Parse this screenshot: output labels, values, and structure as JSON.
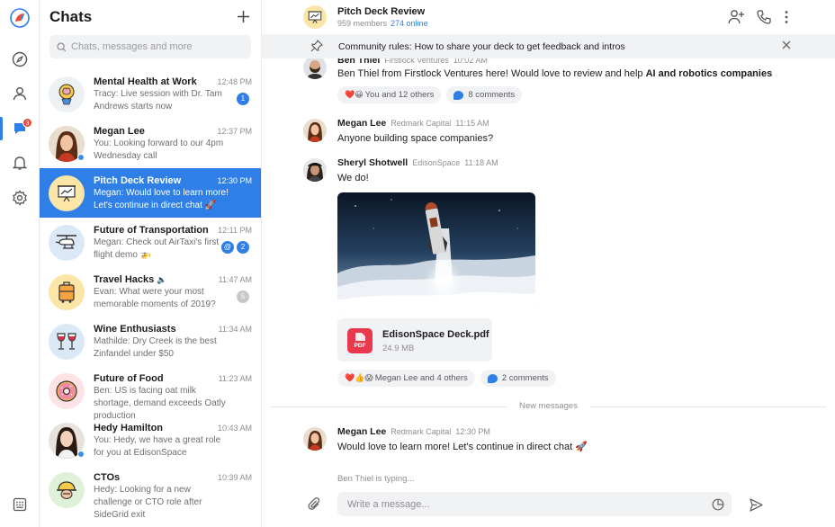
{
  "colors": {
    "accent": "#2f7fe6",
    "badge": "#e84b3c",
    "pdf": "#e8394f"
  },
  "rail": {
    "items": [
      "logo-icon",
      "compass-icon",
      "profile-icon",
      "chat-icon",
      "bell-icon",
      "gear-icon",
      "grid-icon"
    ],
    "chat_badge": "3"
  },
  "list": {
    "title": "Chats",
    "search_placeholder": "Chats, messages and more",
    "items": [
      {
        "name": "Mental Health at Work",
        "time": "12:48 PM",
        "preview": "Tracy: Live session with Dr. Tam Andrews starts now",
        "counts": [
          "1"
        ],
        "avatar_icon": "brain-icon"
      },
      {
        "name": "Megan Lee",
        "time": "12:37 PM",
        "preview": "You: Looking forward to our 4pm Wednesday call",
        "counts": [],
        "avatar_icon": "person-photo"
      },
      {
        "name": "Pitch Deck Review",
        "time": "12:30 PM",
        "preview": "Megan: Would love to learn more! Let's continue in direct chat 🚀",
        "counts": [],
        "avatar_icon": "presentation-icon"
      },
      {
        "name": "Future of Transportation",
        "time": "12:11 PM",
        "preview": "Megan: Check out AirTaxi's first flight demo 🚁",
        "counts": [
          "@",
          "2"
        ],
        "avatar_icon": "helicopter-icon"
      },
      {
        "name": "Travel Hacks",
        "time": "11:47 AM",
        "preview": "Evan: What were your most memorable moments of 2019?",
        "counts": [
          "5"
        ],
        "avatar_icon": "suitcase-icon"
      },
      {
        "name": "Wine Enthusiasts",
        "time": "11:34 AM",
        "preview": "Mathilde: Dry Creek is the best Zinfandel under $50",
        "counts": [],
        "avatar_icon": "wine-icon"
      },
      {
        "name": "Future of Food",
        "time": "11:23 AM",
        "preview": "Ben: US is facing oat milk shortage, demand exceeds Oatly production",
        "counts": [],
        "avatar_icon": "donut-icon"
      },
      {
        "name": "Hedy Hamilton",
        "time": "10:43 AM",
        "preview": "You: Hedy, we have a great role for you at EdisonSpace",
        "counts": [],
        "avatar_icon": "person-photo"
      },
      {
        "name": "CTOs",
        "time": "10:39 AM",
        "preview": "Hedy: Looking for a new challenge or CTO role after SideGrid exit",
        "counts": [],
        "avatar_icon": "helmet-icon"
      }
    ]
  },
  "header": {
    "title": "Pitch Deck Review",
    "members": "959 members",
    "online": "274 online"
  },
  "pinned": {
    "text": "Community rules: How to share your deck to get feedback and intros"
  },
  "messages": [
    {
      "name": "Ben Thiel",
      "company": "Firstlock Ventures",
      "time": "10:02 AM",
      "text_plain": "Ben Thiel from Firstlock Ventures here! Would love to review and help ",
      "text_bold": "AI and robotics companies",
      "reactions": {
        "emoji": "❤️😀",
        "who": "You and 12 others"
      },
      "comments": "8 comments"
    },
    {
      "name": "Megan Lee",
      "company": "Redmark Capital",
      "time": "11:15 AM",
      "text": "Anyone building space companies?"
    },
    {
      "name": "Sheryl Shotwell",
      "company": "EdisonSpace",
      "time": "11:18 AM",
      "text": "We do!",
      "attachment": {
        "name": "EdisonSpace Deck.pdf",
        "size": "24.9 MB",
        "type": "PDF"
      },
      "reactions": {
        "emoji": "❤️👍😱",
        "who": "Megan Lee and 4 others"
      },
      "comments": "2 comments"
    },
    {
      "name": "Megan Lee",
      "company": "Redmark Capital",
      "time": "12:30 PM",
      "text": "Would love to learn more! Let's continue in direct chat 🚀"
    }
  ],
  "new_messages_label": "New messages",
  "typing": "Ben Thiel is typing...",
  "composer": {
    "placeholder": "Write a message..."
  }
}
